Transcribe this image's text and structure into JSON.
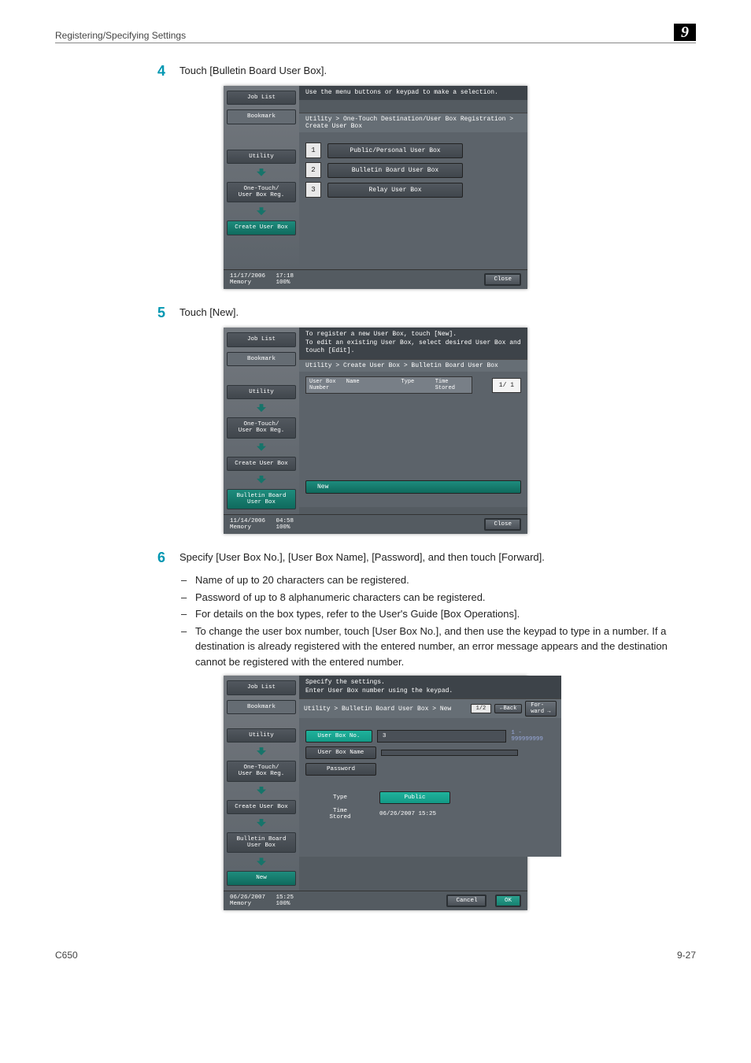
{
  "header": {
    "section": "Registering/Specifying Settings",
    "chapter": "9"
  },
  "steps": {
    "s4": {
      "num": "4",
      "text": "Touch [Bulletin Board User Box]."
    },
    "s5": {
      "num": "5",
      "text": "Touch [New]."
    },
    "s6": {
      "num": "6",
      "text": "Specify [User Box No.], [User Box Name], [Password], and then touch [Forward]."
    }
  },
  "bullets": {
    "b1": "Name of up to 20 characters can be registered.",
    "b2": "Password of up to 8 alphanumeric characters can be registered.",
    "b3": "For details on the box types, refer to the User's Guide [Box Operations].",
    "b4": "To change the user box number, touch [User Box No.], and then use the keypad to type in a number. If a destination is already registered with the entered number, an error message appears and the destination cannot be registered with the entered number."
  },
  "screen1": {
    "instruction": "Use the menu buttons or keypad to make a selection.",
    "path": "Utility > One-Touch Destination/User Box Registration > Create User Box",
    "left": {
      "job_list": "Job List",
      "bookmark": "Bookmark",
      "utility": "Utility",
      "one_touch": "One-Touch/\nUser Box Reg.",
      "create": "Create User Box"
    },
    "opt1": {
      "n": "1",
      "label": "Public/Personal User Box"
    },
    "opt2": {
      "n": "2",
      "label": "Bulletin Board User Box"
    },
    "opt3": {
      "n": "3",
      "label": "Relay User Box"
    },
    "footer_left": "11/17/2006   17:18\nMemory       100%",
    "close": "Close"
  },
  "screen2": {
    "instruction": "To register a new User Box, touch [New].\nTo edit an existing User Box, select desired User Box and touch [Edit].",
    "path": "Utility > Create User Box > Bulletin Board User Box",
    "left": {
      "job_list": "Job List",
      "bookmark": "Bookmark",
      "utility": "Utility",
      "one_touch": "One-Touch/\nUser Box Reg.",
      "create": "Create User Box",
      "bulletin": "Bulletin Board\nUser Box"
    },
    "cols": {
      "no": "User Box\nNumber",
      "name": "Name",
      "type": "Type",
      "time": "Time\nStored"
    },
    "page": "1/  1",
    "new": "New",
    "footer_left": "11/14/2006   04:58\nMemory       100%",
    "close": "Close"
  },
  "screen3": {
    "instruction": "Specify the settings.\nEnter User Box number using the keypad.",
    "path": "Utility > Bulletin Board User Box > New",
    "pagenum": "1/2",
    "back": "←Back",
    "forward": "For-\nward →",
    "left": {
      "job_list": "Job List",
      "bookmark": "Bookmark",
      "utility": "Utility",
      "one_touch": "One-Touch/\nUser Box Reg.",
      "create": "Create User Box",
      "bulletin": "Bulletin Board\nUser Box",
      "new": "New"
    },
    "fields": {
      "no_label": "User Box No.",
      "no_value": "3",
      "range": "1 - 999999999",
      "name_label": "User Box Name",
      "pw_label": "Password",
      "type_label": "Type",
      "type_value": "Public",
      "time_label": "Time\nStored",
      "time_value": "06/26/2007  15:25"
    },
    "footer_left": "06/26/2007   15:25\nMemory       100%",
    "cancel": "Cancel",
    "ok": "OK"
  },
  "footer": {
    "model": "C650",
    "page": "9-27"
  }
}
